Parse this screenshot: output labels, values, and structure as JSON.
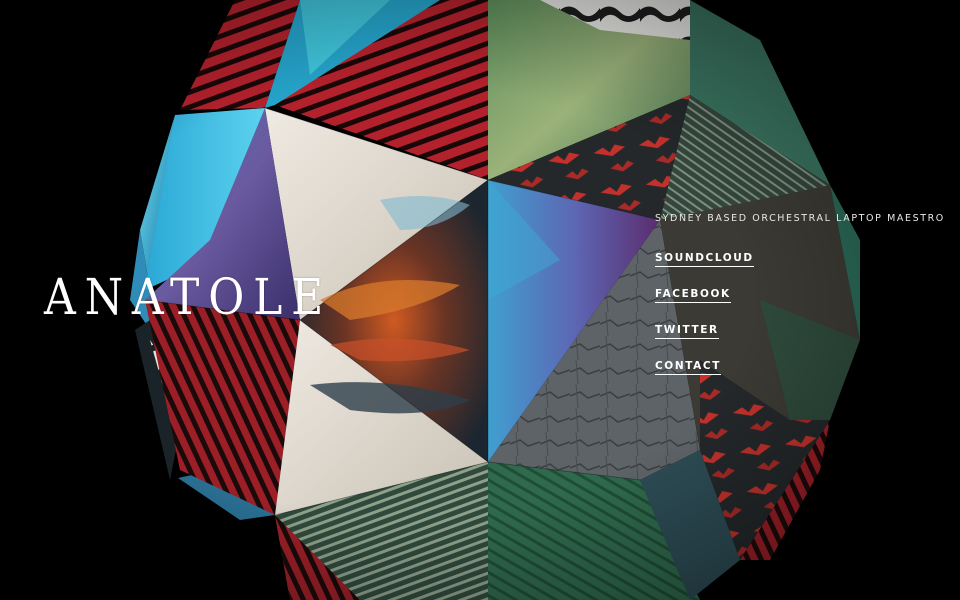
{
  "site": {
    "logo_text": "ANATOLE",
    "tagline": "SYDNEY BASED ORCHESTRAL LAPTOP MAESTRO"
  },
  "nav": {
    "items": [
      {
        "label": "SOUNDCLOUD"
      },
      {
        "label": "FACEBOOK"
      },
      {
        "label": "TWITTER"
      },
      {
        "label": "CONTACT"
      }
    ]
  },
  "colors": {
    "background": "#000000",
    "text": "#ffffff"
  }
}
